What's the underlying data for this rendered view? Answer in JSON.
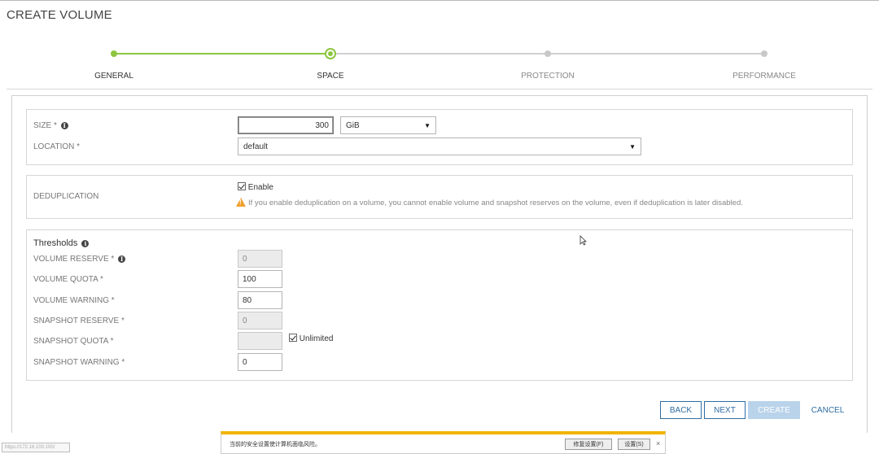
{
  "page": {
    "title": "CREATE VOLUME"
  },
  "wizard": {
    "steps": [
      {
        "label": "GENERAL",
        "state": "done"
      },
      {
        "label": "SPACE",
        "state": "current"
      },
      {
        "label": "PROTECTION",
        "state": "todo"
      },
      {
        "label": "PERFORMANCE",
        "state": "todo"
      }
    ]
  },
  "space": {
    "size_label": "SIZE *",
    "size_value": "300",
    "size_unit": "GiB",
    "location_label": "LOCATION *",
    "location_value": "default"
  },
  "dedup": {
    "label": "DEDUPLICATION",
    "enable_label": "Enable",
    "enabled": true,
    "warning": "If you enable deduplication on a volume, you cannot enable volume and snapshot reserves on the volume, even if deduplication is later disabled."
  },
  "thresholds": {
    "title": "Thresholds",
    "volume_reserve_label": "VOLUME RESERVE *",
    "volume_reserve_value": "0",
    "volume_quota_label": "VOLUME QUOTA *",
    "volume_quota_value": "100",
    "volume_warning_label": "VOLUME WARNING *",
    "volume_warning_value": "80",
    "snapshot_reserve_label": "SNAPSHOT RESERVE *",
    "snapshot_reserve_value": "0",
    "snapshot_quota_label": "SNAPSHOT QUOTA *",
    "snapshot_quota_value": "",
    "unlimited_label": "Unlimited",
    "unlimited_checked": true,
    "snapshot_warning_label": "SNAPSHOT WARNING *",
    "snapshot_warning_value": "0"
  },
  "buttons": {
    "back": "BACK",
    "next": "NEXT",
    "create": "CREATE",
    "cancel": "CANCEL"
  },
  "statusbar": {
    "url_tip": "https://172.16.100.100/"
  },
  "notification": {
    "text": "当前的安全设置使计算机面临风险。",
    "fix_button": "修复设置(F)",
    "settings_button": "设置(S)",
    "close": "×"
  },
  "colors": {
    "accent_green": "#8dc63f",
    "button_blue": "#2e6da4",
    "warning_orange": "#f0a030",
    "notify_bar": "#f0b400"
  }
}
